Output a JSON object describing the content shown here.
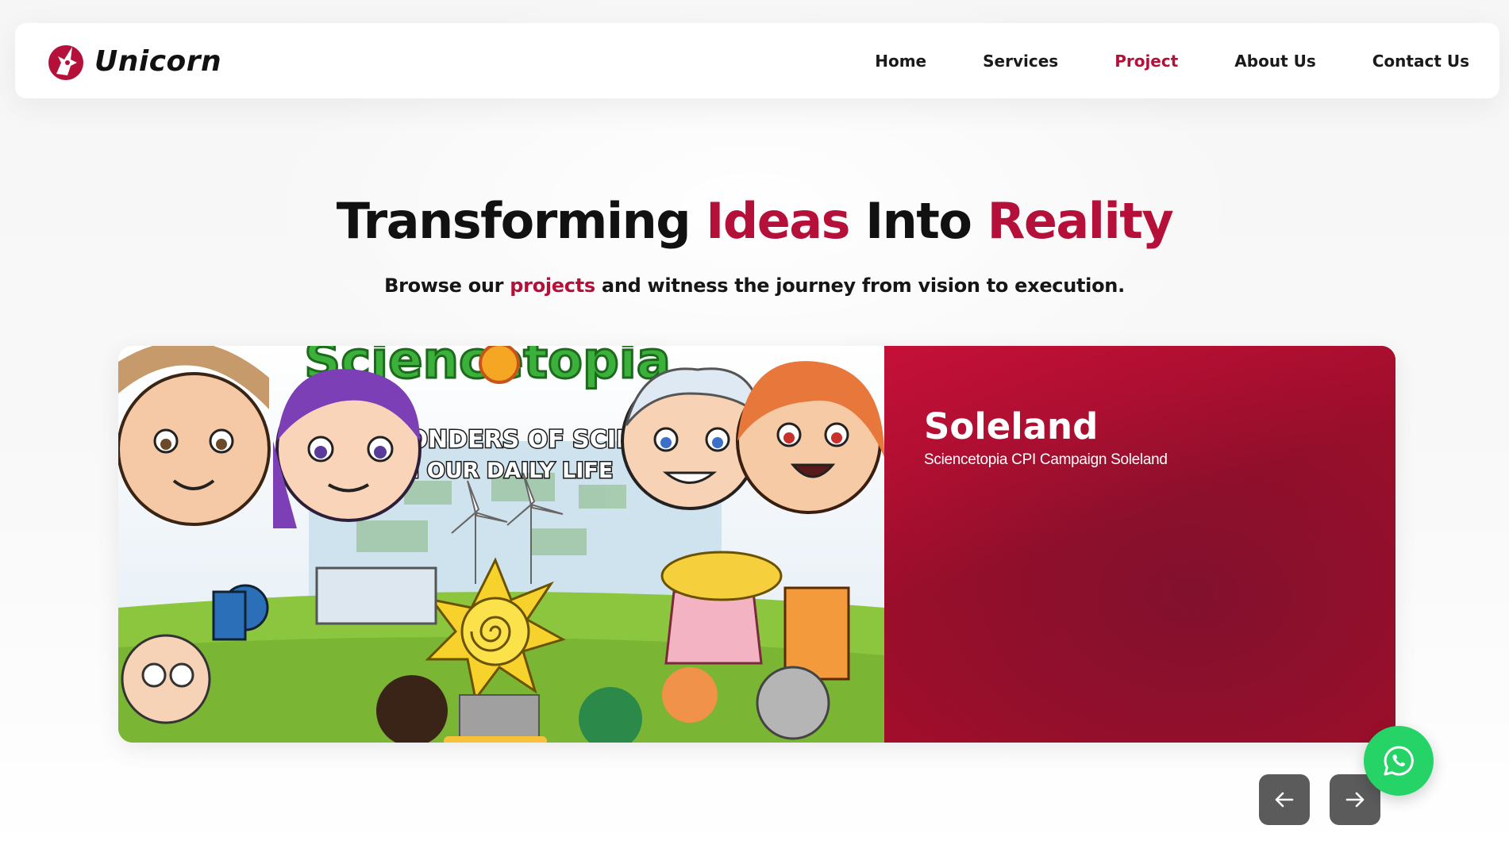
{
  "brand": {
    "name": "Unicorn",
    "logo_icon": "unicorn-logo-icon",
    "accent_color": "#b5103a"
  },
  "nav": {
    "items": [
      {
        "label": "Home",
        "active": false
      },
      {
        "label": "Services",
        "active": false
      },
      {
        "label": "Project",
        "active": true
      },
      {
        "label": "About Us",
        "active": false
      },
      {
        "label": "Contact Us",
        "active": false
      }
    ]
  },
  "hero": {
    "title_part1": "Transforming ",
    "title_accent1": "Ideas",
    "title_part2": " Into ",
    "title_accent2": "Reality",
    "subtitle_part1": "Browse our ",
    "subtitle_accent": "projects",
    "subtitle_part2": " and witness the journey from vision to execution."
  },
  "project": {
    "image_banner_line1": "THE WONDERS OF SCIENCE",
    "image_banner_line2": "IN OUR DAILY LIFE",
    "image_logo_text": "Sciencetopia",
    "title": "Soleland",
    "description": "Sciencetopia CPI Campaign Soleland",
    "panel_color": "#a80e2d"
  },
  "carousel": {
    "prev_icon": "arrow-left-icon",
    "next_icon": "arrow-right-icon",
    "button_color": "#5b5b5b"
  },
  "whatsapp": {
    "icon": "whatsapp-icon",
    "color": "#25d366"
  }
}
